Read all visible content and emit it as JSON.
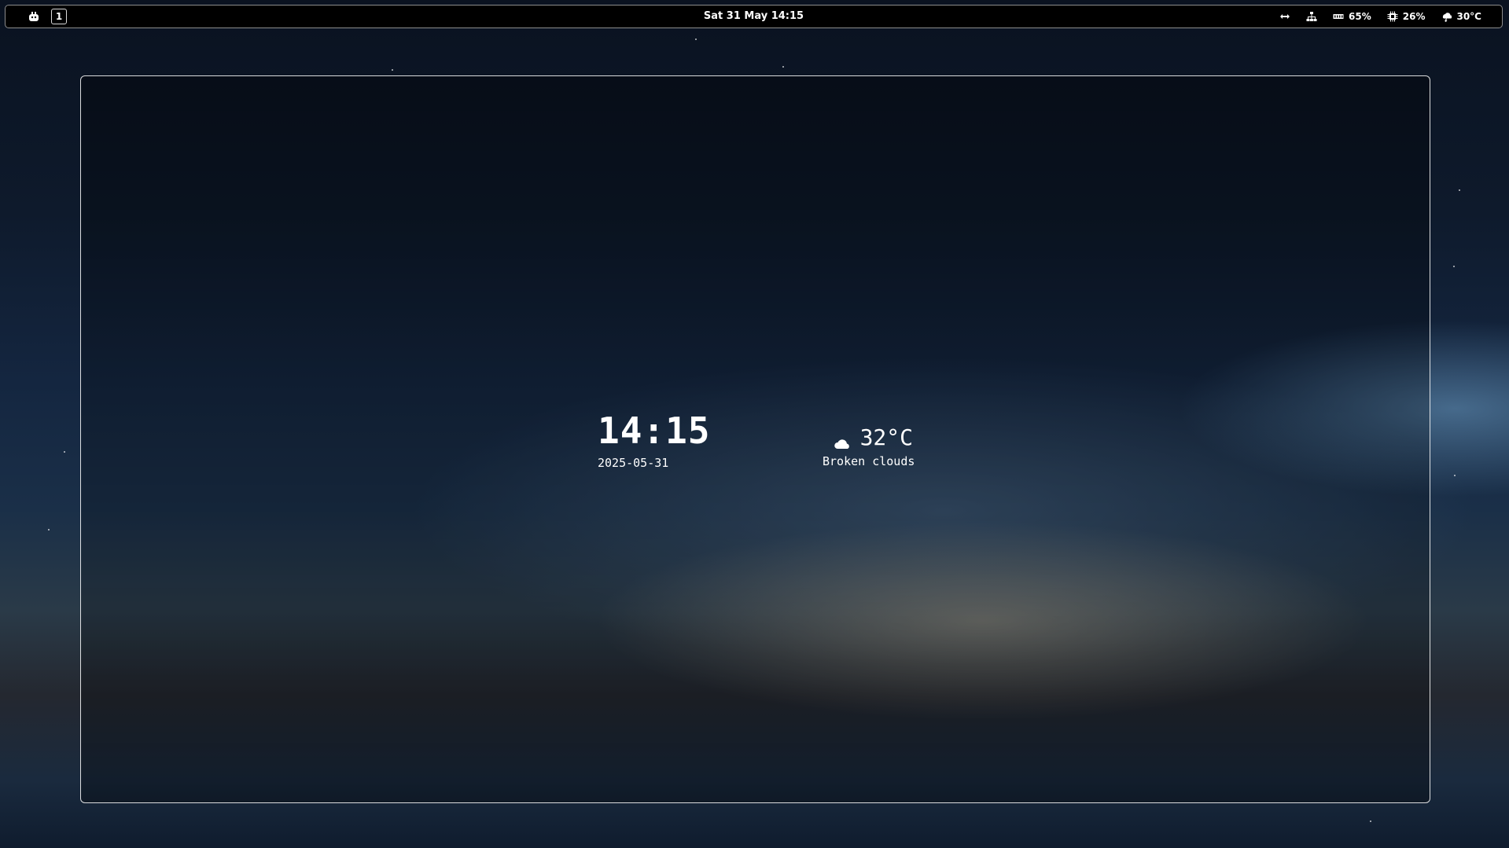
{
  "topbar": {
    "workspace": "1",
    "datetime": "Sat 31 May 14:15",
    "indicators": {
      "arrows_icon": "left-right-arrow-icon",
      "network_icon": "network-icon",
      "memory": "65%",
      "memory_icon": "memory-icon",
      "cpu": "26%",
      "cpu_icon": "cpu-icon",
      "temperature": "30°C",
      "temperature_icon": "temperature-icon"
    }
  },
  "widget": {
    "time": "14:15",
    "date": "2025-05-31",
    "weather": {
      "icon": "cloud-icon",
      "temp": "32°C",
      "description": "Broken clouds"
    }
  },
  "colors": {
    "bar_background": "#000000",
    "text": "#ffffff",
    "frame_border": "#ffffff"
  }
}
